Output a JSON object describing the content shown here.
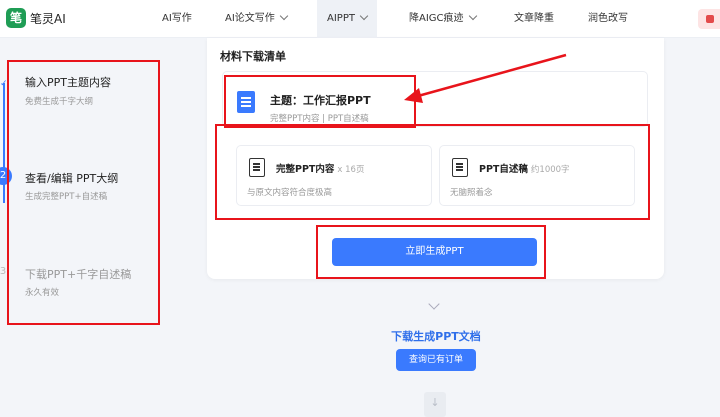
{
  "app": {
    "logo_char": "笔",
    "name": "笔灵AI"
  },
  "nav": {
    "items": [
      {
        "label": "AI写作"
      },
      {
        "label": "AI论文写作"
      },
      {
        "label": "AIPPT"
      },
      {
        "label": "降AIGC痕迹"
      },
      {
        "label": "文章降重"
      },
      {
        "label": "润色改写"
      }
    ]
  },
  "steps": [
    {
      "number": "1",
      "title": "输入PPT主题内容",
      "subtitle": "免费生成千字大纲"
    },
    {
      "number": "2",
      "title": "查看/编辑 PPT大纲",
      "subtitle": "生成完整PPT+自述稿"
    },
    {
      "number": "3",
      "title": "下载PPT+千字自述稿",
      "subtitle": "永久有效"
    }
  ],
  "materials": {
    "heading": "材料下载清单",
    "topic_title": "主题：工作汇报PPT",
    "topic_subtitle": "完整PPT内容 | PPT自述稿",
    "items": [
      {
        "title": "完整PPT内容",
        "meta": "x 16页",
        "subtitle": "与原文内容符合度极高"
      },
      {
        "title": "PPT自述稿",
        "meta": "约1000字",
        "subtitle": "无脑照着念"
      }
    ],
    "generate_label": "立即生成PPT"
  },
  "download": {
    "title": "下载生成PPT文档",
    "order_button": "查询已有订单"
  },
  "colors": {
    "accent": "#3a7afe",
    "annotation": "#e8141b"
  }
}
